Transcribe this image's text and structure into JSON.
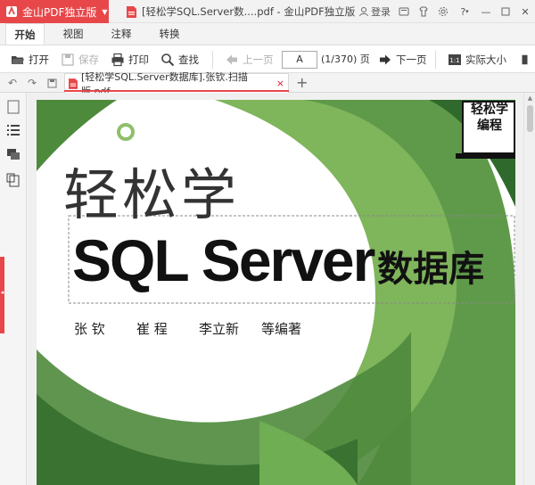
{
  "app": {
    "brand": "金山PDF独立版",
    "window_title": "[轻松学SQL.Server数....pdf - 金山PDF独立版",
    "login_label": "登录"
  },
  "menu": {
    "tabs": [
      {
        "label": "开始",
        "active": true
      },
      {
        "label": "视图",
        "active": false
      },
      {
        "label": "注释",
        "active": false
      },
      {
        "label": "转换",
        "active": false
      }
    ]
  },
  "toolbar": {
    "open": "打开",
    "save": "保存",
    "print": "打印",
    "find": "查找",
    "prev_page": "上一页",
    "page_input": "A",
    "page_count": "(1/370) 页",
    "next_page": "下一页",
    "actual_size": "实际大小"
  },
  "doc_tab": {
    "label": "[轻松学SQL.Server数据库].张钦.扫描版.pdf",
    "close": "×",
    "add": "+"
  },
  "cover": {
    "series_line1": "轻松学",
    "series_line2": "编程",
    "title_cn": "轻松学",
    "title_main": "SQL Server",
    "title_suffix": "数据库",
    "authors": [
      "张 钦",
      "崔 程",
      "李立新",
      "等编著"
    ]
  },
  "colors": {
    "brand_red": "#e8474a",
    "cover_dark_green": "#3c7a3c",
    "cover_light_green": "#8fbf6a"
  }
}
